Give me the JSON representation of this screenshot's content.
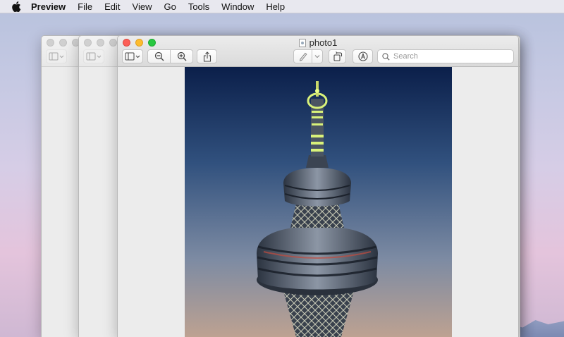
{
  "menubar": {
    "app_name": "Preview",
    "items": [
      "File",
      "Edit",
      "View",
      "Go",
      "Tools",
      "Window",
      "Help"
    ]
  },
  "window": {
    "title": "photo1",
    "search": {
      "placeholder": "Search",
      "value": ""
    }
  },
  "icons": {
    "apple": "apple-logo-icon",
    "sidebar": "sidebar-toggle-icon",
    "zoom_out": "zoom-out-icon",
    "zoom_in": "zoom-in-icon",
    "share": "share-icon",
    "markup_pen": "pen-icon",
    "rotate": "rotate-icon",
    "markup_toolbar": "markup-icon",
    "search": "search-icon",
    "document": "image-document-icon"
  },
  "colors": {
    "close": "#fc5f57",
    "minimize": "#fdbc2e",
    "zoom": "#28c840",
    "sky_top": "#0b1f4a",
    "sky_bottom": "#c1a390",
    "tower_lights": "#d9f27a"
  }
}
